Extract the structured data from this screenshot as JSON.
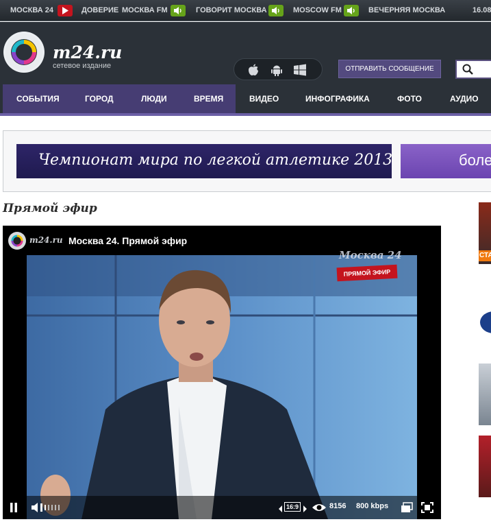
{
  "topbar": {
    "items": [
      "МОСКВА 24",
      "ДОВЕРИЕ",
      "МОСКВА FM",
      "ГОВОРИТ МОСКВА",
      "MOSCOW FM",
      "ВЕЧЕРНЯЯ МОСКВА"
    ],
    "date": "16.08"
  },
  "header": {
    "logo_text": "m24.ru",
    "logo_subtitle": "сетевое издание",
    "os_icons": [
      "apple-icon",
      "android-icon",
      "windows-icon"
    ],
    "send_button": "ОТПРАВИТЬ СООБЩЕНИЕ",
    "search_icon": "search-icon"
  },
  "nav": {
    "items": [
      "СОБЫТИЯ",
      "ГОРОД",
      "ЛЮДИ",
      "ВРЕМЯ",
      "ВИДЕО",
      "ИНФОГРАФИКА",
      "ФОТО",
      "АУДИО"
    ]
  },
  "banner": {
    "main_text": "Чемпионат мира по легкой атлетике 2013",
    "right_text": "боле"
  },
  "section_title": "Прямой эфир",
  "player": {
    "brand": "m24.ru",
    "title": "Москва 24. Прямой эфир",
    "channel_watermark": "Москва 24",
    "live_badge": "ПРЯМОЙ ЭФИР",
    "aspect": "16:9",
    "viewers": "8156",
    "bitrate": "800 kbps"
  },
  "colors": {
    "accent": "#463d73",
    "live": "#c4141e",
    "radio_badge": "#66a31a"
  },
  "sidebar_thumb_label": "СТА"
}
